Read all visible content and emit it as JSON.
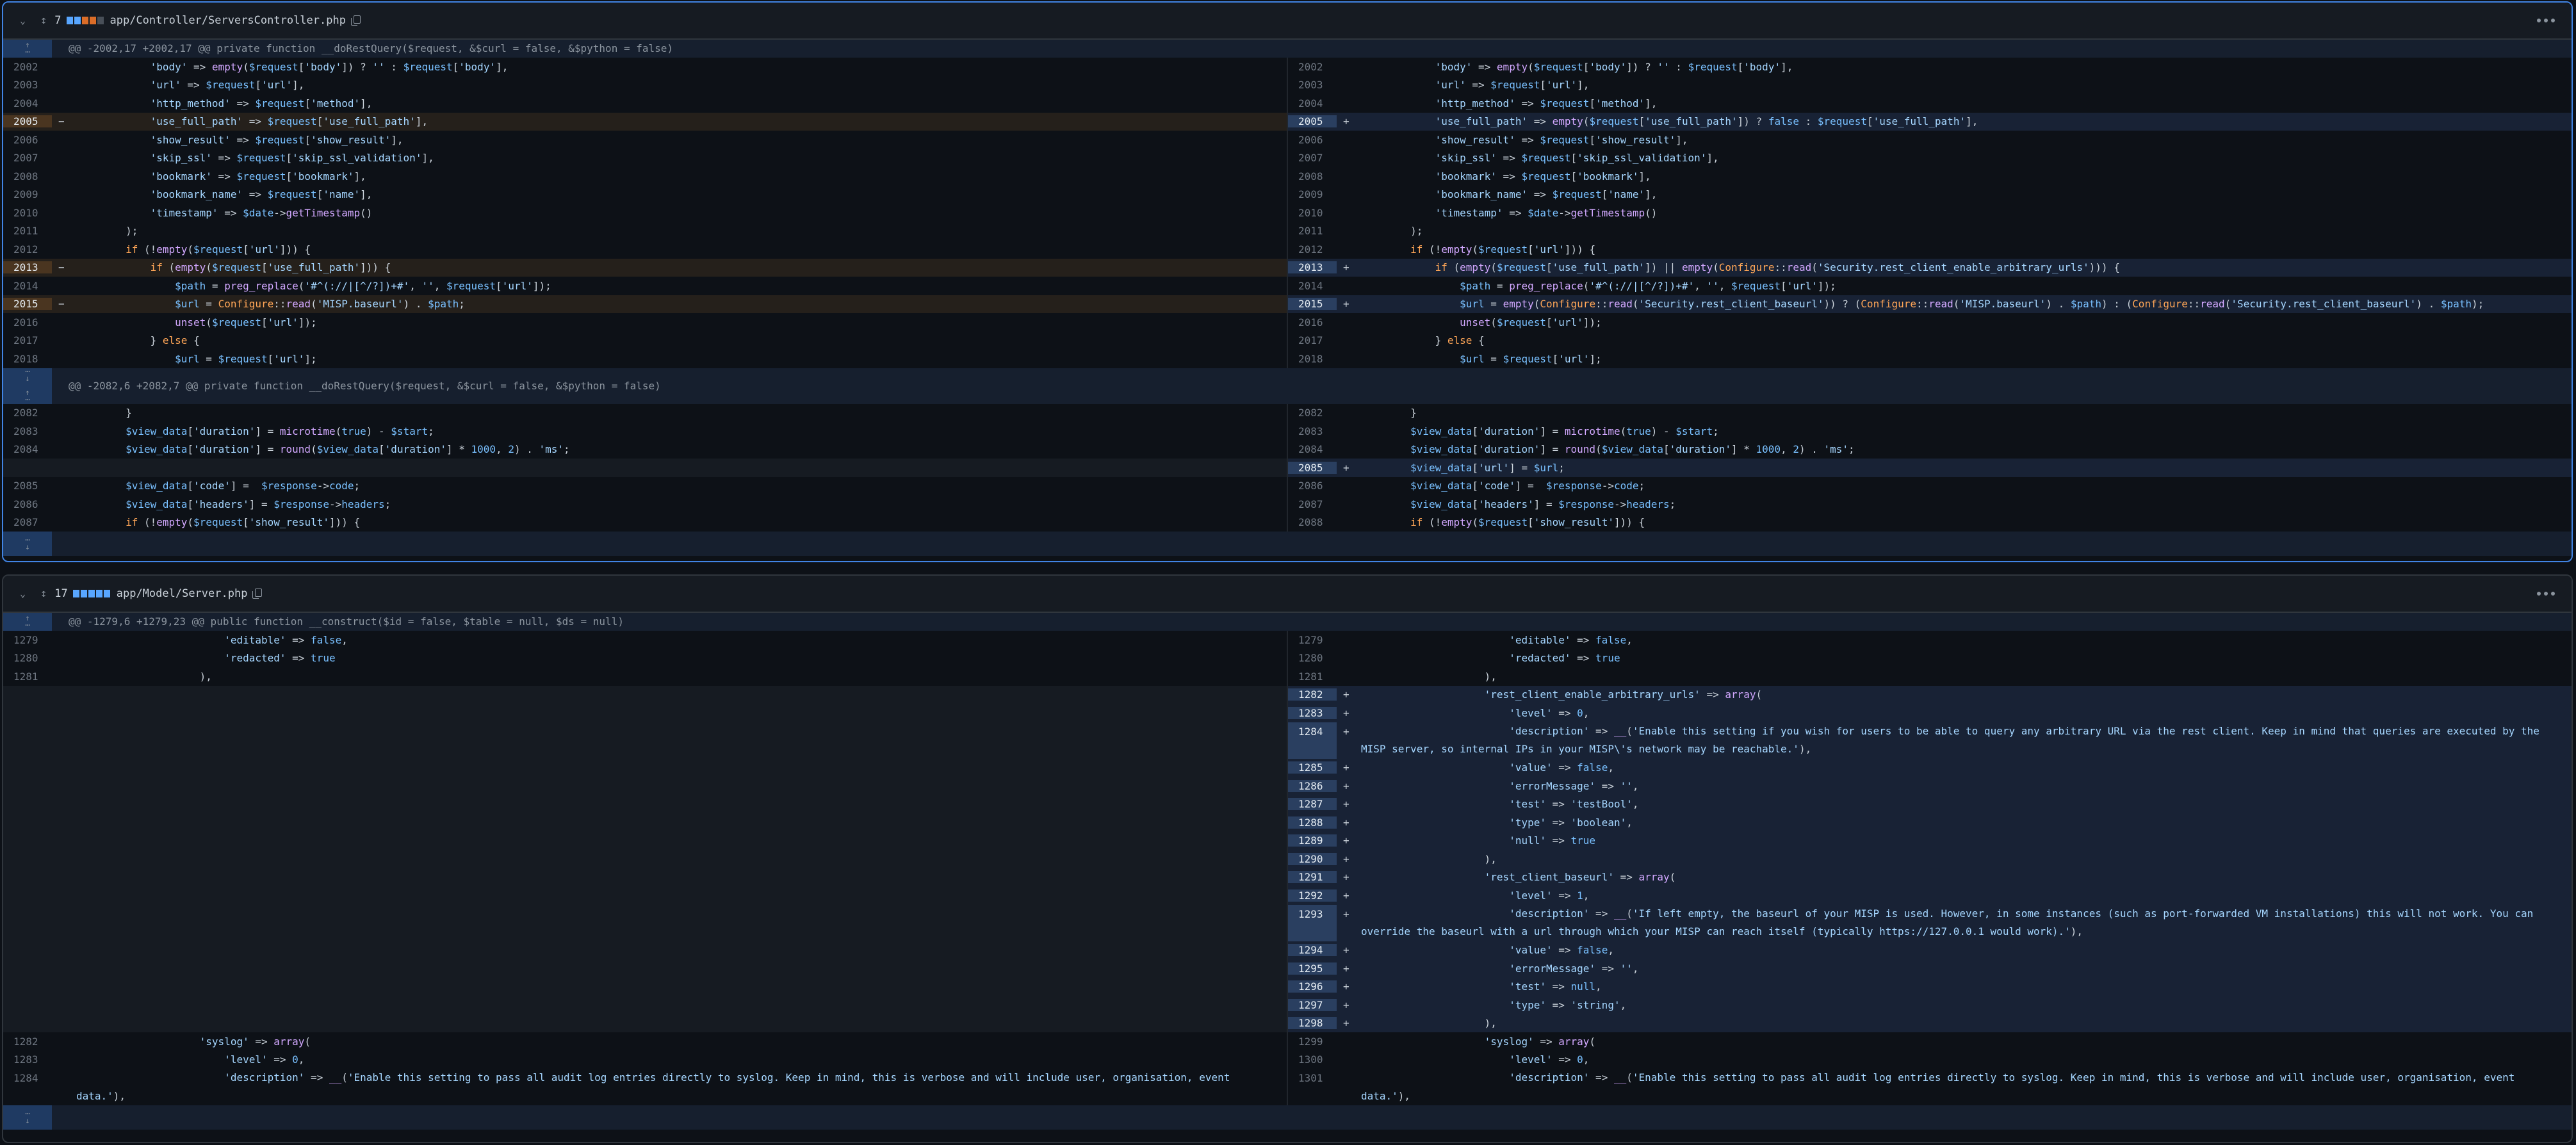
{
  "files": [
    {
      "collapse_icon": "chevron-down",
      "expand_icon": "unfold",
      "changes": "7",
      "bars": [
        "#58a6ff",
        "#58a6ff",
        "#db6d28",
        "#db6d28",
        "#484f58"
      ],
      "path": "app/Controller/ServersController.php",
      "hunks": [
        {
          "header": "@@ -2002,17 +2002,17 @@ private function __doRestQuery($request, &$curl = false, &$python = false)",
          "left": [
            {
              "ln": "2002",
              "type": "ctx",
              "code": "            'body' => empty($request['body']) ? '' : $request['body'],"
            },
            {
              "ln": "2003",
              "type": "ctx",
              "code": "            'url' => $request['url'],"
            },
            {
              "ln": "2004",
              "type": "ctx",
              "code": "            'http_method' => $request['method'],"
            },
            {
              "ln": "2005",
              "type": "del",
              "code": "            'use_full_path' => $request['use_full_path'],"
            },
            {
              "ln": "2006",
              "type": "ctx",
              "code": "            'show_result' => $request['show_result'],"
            },
            {
              "ln": "2007",
              "type": "ctx",
              "code": "            'skip_ssl' => $request['skip_ssl_validation'],"
            },
            {
              "ln": "2008",
              "type": "ctx",
              "code": "            'bookmark' => $request['bookmark'],"
            },
            {
              "ln": "2009",
              "type": "ctx",
              "code": "            'bookmark_name' => $request['name'],"
            },
            {
              "ln": "2010",
              "type": "ctx",
              "code": "            'timestamp' => $date->getTimestamp()"
            },
            {
              "ln": "2011",
              "type": "ctx",
              "code": "        );"
            },
            {
              "ln": "2012",
              "type": "ctx",
              "code": "        if (!empty($request['url'])) {"
            },
            {
              "ln": "2013",
              "type": "del",
              "code": "            if (empty($request['use_full_path'])) {"
            },
            {
              "ln": "2014",
              "type": "ctx",
              "code": "                $path = preg_replace('#^(://|[^/?])+#', '', $request['url']);"
            },
            {
              "ln": "2015",
              "type": "del",
              "code": "                $url = Configure::read('MISP.baseurl') . $path;"
            },
            {
              "ln": "2016",
              "type": "ctx",
              "code": "                unset($request['url']);"
            },
            {
              "ln": "2017",
              "type": "ctx",
              "code": "            } else {"
            },
            {
              "ln": "2018",
              "type": "ctx",
              "code": "                $url = $request['url'];"
            }
          ],
          "right": [
            {
              "ln": "2002",
              "type": "ctx",
              "code": "            'body' => empty($request['body']) ? '' : $request['body'],"
            },
            {
              "ln": "2003",
              "type": "ctx",
              "code": "            'url' => $request['url'],"
            },
            {
              "ln": "2004",
              "type": "ctx",
              "code": "            'http_method' => $request['method'],"
            },
            {
              "ln": "2005",
              "type": "add",
              "code": "            'use_full_path' => empty($request['use_full_path']) ? false : $request['use_full_path'],"
            },
            {
              "ln": "2006",
              "type": "ctx",
              "code": "            'show_result' => $request['show_result'],"
            },
            {
              "ln": "2007",
              "type": "ctx",
              "code": "            'skip_ssl' => $request['skip_ssl_validation'],"
            },
            {
              "ln": "2008",
              "type": "ctx",
              "code": "            'bookmark' => $request['bookmark'],"
            },
            {
              "ln": "2009",
              "type": "ctx",
              "code": "            'bookmark_name' => $request['name'],"
            },
            {
              "ln": "2010",
              "type": "ctx",
              "code": "            'timestamp' => $date->getTimestamp()"
            },
            {
              "ln": "2011",
              "type": "ctx",
              "code": "        );"
            },
            {
              "ln": "2012",
              "type": "ctx",
              "code": "        if (!empty($request['url'])) {"
            },
            {
              "ln": "2013",
              "type": "add",
              "code": "            if (empty($request['use_full_path']) || empty(Configure::read('Security.rest_client_enable_arbitrary_urls'))) {"
            },
            {
              "ln": "2014",
              "type": "ctx",
              "code": "                $path = preg_replace('#^(://|[^/?])+#', '', $request['url']);"
            },
            {
              "ln": "2015",
              "type": "add",
              "code": "                $url = empty(Configure::read('Security.rest_client_baseurl')) ? (Configure::read('MISP.baseurl') . $path) : (Configure::read('Security.rest_client_baseurl') . $path);"
            },
            {
              "ln": "2016",
              "type": "ctx",
              "code": "                unset($request['url']);"
            },
            {
              "ln": "2017",
              "type": "ctx",
              "code": "            } else {"
            },
            {
              "ln": "2018",
              "type": "ctx",
              "code": "                $url = $request['url'];"
            }
          ]
        },
        {
          "header": "@@ -2082,6 +2082,7 @@ private function __doRestQuery($request, &$curl = false, &$python = false)",
          "left": [
            {
              "ln": "2082",
              "type": "ctx",
              "code": "        }"
            },
            {
              "ln": "2083",
              "type": "ctx",
              "code": "        $view_data['duration'] = microtime(true) - $start;"
            },
            {
              "ln": "2084",
              "type": "ctx",
              "code": "        $view_data['duration'] = round($view_data['duration'] * 1000, 2) . 'ms';"
            },
            {
              "ln": "",
              "type": "empty",
              "code": ""
            },
            {
              "ln": "2085",
              "type": "ctx",
              "code": "        $view_data['code'] =  $response->code;"
            },
            {
              "ln": "2086",
              "type": "ctx",
              "code": "        $view_data['headers'] = $response->headers;"
            },
            {
              "ln": "2087",
              "type": "ctx",
              "code": "        if (!empty($request['show_result'])) {"
            }
          ],
          "right": [
            {
              "ln": "2082",
              "type": "ctx",
              "code": "        }"
            },
            {
              "ln": "2083",
              "type": "ctx",
              "code": "        $view_data['duration'] = microtime(true) - $start;"
            },
            {
              "ln": "2084",
              "type": "ctx",
              "code": "        $view_data['duration'] = round($view_data['duration'] * 1000, 2) . 'ms';"
            },
            {
              "ln": "2085",
              "type": "add",
              "code": "        $view_data['url'] = $url;"
            },
            {
              "ln": "2086",
              "type": "ctx",
              "code": "        $view_data['code'] =  $response->code;"
            },
            {
              "ln": "2087",
              "type": "ctx",
              "code": "        $view_data['headers'] = $response->headers;"
            },
            {
              "ln": "2088",
              "type": "ctx",
              "code": "        if (!empty($request['show_result'])) {"
            }
          ]
        }
      ]
    },
    {
      "collapse_icon": "chevron-down",
      "expand_icon": "unfold",
      "changes": "17",
      "bars": [
        "#58a6ff",
        "#58a6ff",
        "#58a6ff",
        "#58a6ff",
        "#58a6ff"
      ],
      "path": "app/Model/Server.php",
      "hunks": [
        {
          "header": "@@ -1279,6 +1279,23 @@ public function __construct($id = false, $table = null, $ds = null)",
          "left": [
            {
              "ln": "1279",
              "type": "ctx",
              "code": "                        'editable' => false,"
            },
            {
              "ln": "1280",
              "type": "ctx",
              "code": "                        'redacted' => true"
            },
            {
              "ln": "1281",
              "type": "ctx",
              "code": "                    ),"
            }
          ],
          "right": [
            {
              "ln": "1279",
              "type": "ctx",
              "code": "                        'editable' => false,"
            },
            {
              "ln": "1280",
              "type": "ctx",
              "code": "                        'redacted' => true"
            },
            {
              "ln": "1281",
              "type": "ctx",
              "code": "                    ),"
            },
            {
              "ln": "1282",
              "type": "add",
              "code": "                    'rest_client_enable_arbitrary_urls' => array("
            },
            {
              "ln": "1283",
              "type": "add",
              "code": "                        'level' => 0,"
            },
            {
              "ln": "1284",
              "type": "add",
              "wrap": true,
              "code": "                        'description' => __('Enable this setting if you wish for users to be able to query any arbitrary URL via the rest client. Keep in mind that queries are executed by the MISP server, so internal IPs in your MISP\\'s network may be reachable.'),"
            },
            {
              "ln": "1285",
              "type": "add",
              "code": "                        'value' => false,"
            },
            {
              "ln": "1286",
              "type": "add",
              "code": "                        'errorMessage' => '',"
            },
            {
              "ln": "1287",
              "type": "add",
              "code": "                        'test' => 'testBool',"
            },
            {
              "ln": "1288",
              "type": "add",
              "code": "                        'type' => 'boolean',"
            },
            {
              "ln": "1289",
              "type": "add",
              "code": "                        'null' => true"
            },
            {
              "ln": "1290",
              "type": "add",
              "code": "                    ),"
            },
            {
              "ln": "1291",
              "type": "add",
              "code": "                    'rest_client_baseurl' => array("
            },
            {
              "ln": "1292",
              "type": "add",
              "code": "                        'level' => 1,"
            },
            {
              "ln": "1293",
              "type": "add",
              "wrap": true,
              "code": "                        'description' => __('If left empty, the baseurl of your MISP is used. However, in some instances (such as port-forwarded VM installations) this will not work. You can override the baseurl with a url through which your MISP can reach itself (typically https://127.0.0.1 would work).'),"
            },
            {
              "ln": "1294",
              "type": "add",
              "code": "                        'value' => false,"
            },
            {
              "ln": "1295",
              "type": "add",
              "code": "                        'errorMessage' => '',"
            },
            {
              "ln": "1296",
              "type": "add",
              "code": "                        'test' => null,"
            },
            {
              "ln": "1297",
              "type": "add",
              "code": "                        'type' => 'string',"
            },
            {
              "ln": "1298",
              "type": "add",
              "code": "                    ),"
            },
            {
              "ln": "1299",
              "type": "ctx",
              "code": "                    'syslog' => array("
            },
            {
              "ln": "1300",
              "type": "ctx",
              "code": "                        'level' => 0,"
            },
            {
              "ln": "1301",
              "type": "ctx",
              "wrap": true,
              "code": "                        'description' => __('Enable this setting to pass all audit log entries directly to syslog. Keep in mind, this is verbose and will include user, organisation, event data.'),"
            }
          ],
          "left_tail": [
            {
              "ln": "1282",
              "type": "ctx",
              "code": "                    'syslog' => array("
            },
            {
              "ln": "1283",
              "type": "ctx",
              "code": "                        'level' => 0,"
            },
            {
              "ln": "1284",
              "type": "ctx",
              "wrap": true,
              "code": "                        'description' => __('Enable this setting to pass all audit log entries directly to syslog. Keep in mind, this is verbose and will include user, organisation, event data.'),"
            }
          ]
        }
      ]
    }
  ],
  "markers": {
    "del": "−",
    "add": "+"
  },
  "colors": {
    "accent": "#4184e4",
    "deleted_bg": "#25201b",
    "added_bg": "#182235",
    "highlight": "#2c5190"
  }
}
